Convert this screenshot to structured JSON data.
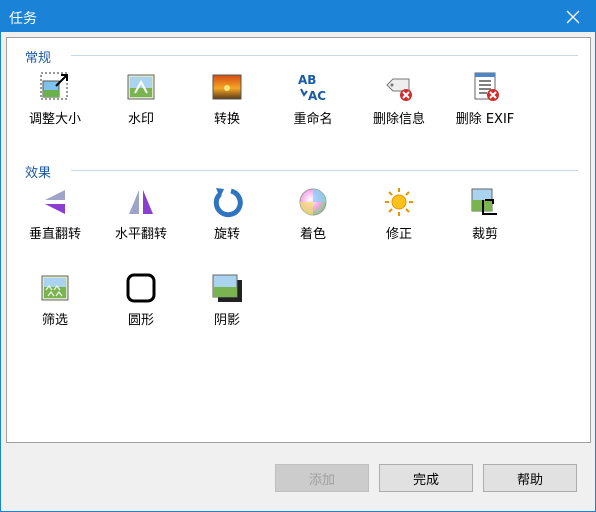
{
  "window": {
    "title": "任务"
  },
  "groups": {
    "general": {
      "title": "常规",
      "items": [
        {
          "label": "调整大小",
          "icon": "resize-icon"
        },
        {
          "label": "水印",
          "icon": "watermark-icon"
        },
        {
          "label": "转换",
          "icon": "convert-icon"
        },
        {
          "label": "重命名",
          "icon": "rename-icon"
        },
        {
          "label": "删除信息",
          "icon": "remove-info-icon"
        },
        {
          "label": "删除 EXIF",
          "icon": "remove-exif-icon"
        }
      ]
    },
    "effects": {
      "title": "效果",
      "items": [
        {
          "label": "垂直翻转",
          "icon": "flip-vertical-icon"
        },
        {
          "label": "水平翻转",
          "icon": "flip-horizontal-icon"
        },
        {
          "label": "旋转",
          "icon": "rotate-icon"
        },
        {
          "label": "着色",
          "icon": "colorize-icon"
        },
        {
          "label": "修正",
          "icon": "adjust-icon"
        },
        {
          "label": "裁剪",
          "icon": "crop-icon"
        },
        {
          "label": "筛选",
          "icon": "filter-icon"
        },
        {
          "label": "圆形",
          "icon": "rounded-icon"
        },
        {
          "label": "阴影",
          "icon": "shadow-icon"
        }
      ]
    }
  },
  "buttons": {
    "add": "添加",
    "finish": "完成",
    "help": "帮助"
  }
}
